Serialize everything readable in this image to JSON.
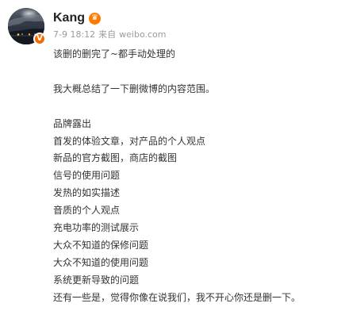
{
  "post": {
    "author": {
      "name": "Kang",
      "member_badge_icon": "crown-icon",
      "verified_badge_icon": "verified-v-icon",
      "verified_badge_text": "V",
      "avatar_icon": "profile-avatar-icon"
    },
    "meta": {
      "time": "7-9 18:12",
      "source_label": "来自",
      "source": "weibo.com"
    },
    "content": {
      "lines": [
        "该删的删完了~都手动处理的",
        "",
        "我大概总结了一下删微博的内容范围。",
        "",
        "品牌露出",
        "首发的体验文章，对产品的个人观点",
        "新品的官方截图，商店的截图",
        "信号的使用问题",
        "发热的如实描述",
        "音质的个人观点",
        "充电功率的测试展示",
        "大众不知道的保修问题",
        "大众不知道的使用问题",
        "系统更新导致的问题",
        "还有一些是，觉得你像在说我们，我不开心你还是删一下。"
      ]
    }
  },
  "colors": {
    "username": "#222222",
    "meta": "#9a9a9a",
    "body_text": "#333333",
    "verified_badge": "#f56b00",
    "member_badge": "#ff7a00"
  }
}
